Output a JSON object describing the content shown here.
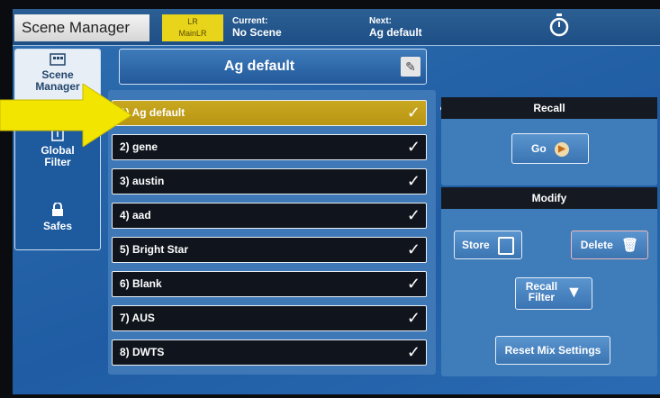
{
  "header": {
    "app_title": "Scene Manager",
    "lr_badge_top": "LR",
    "lr_badge_bottom": "MainLR",
    "current_label": "Current:",
    "current_value": "No Scene",
    "next_label": "Next:",
    "next_value": "Ag default",
    "timer_icon": "stopwatch-icon"
  },
  "sidebar": {
    "items": [
      {
        "label_line1": "Scene",
        "label_line2": "Manager",
        "icon": "scene-manager-icon"
      },
      {
        "label_line1": "Global",
        "label_line2": "Filter",
        "icon": "filter-icon"
      },
      {
        "label_line1": "Safes",
        "label_line2": "",
        "icon": "lock-icon"
      }
    ]
  },
  "selected_scene": {
    "name": "Ag default",
    "edit_icon": "pencil-icon"
  },
  "scenes": [
    {
      "label": "1) Ag default",
      "selected": true
    },
    {
      "label": "2) gene",
      "selected": false
    },
    {
      "label": "3) austin",
      "selected": false
    },
    {
      "label": "4) aad",
      "selected": false
    },
    {
      "label": "5) Bright Star",
      "selected": false
    },
    {
      "label": "6) Blank",
      "selected": false
    },
    {
      "label": "7) AUS",
      "selected": false
    },
    {
      "label": "8) DWTS",
      "selected": false
    }
  ],
  "recall": {
    "header": "Recall",
    "go_label": "Go"
  },
  "modify": {
    "header": "Modify",
    "store_label": "Store",
    "delete_label": "Delete",
    "recall_filter_line1": "Recall",
    "recall_filter_line2": "Filter",
    "reset_label": "Reset Mix Settings"
  },
  "colors": {
    "accent_yellow": "#c9a820",
    "panel_blue": "#3f7cba",
    "annotation_arrow": "#f2e600"
  }
}
